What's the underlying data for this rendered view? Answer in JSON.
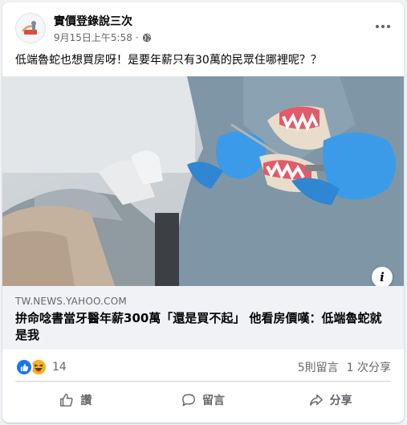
{
  "post": {
    "page_name": "實價登錄說三次",
    "timestamp": "9月15日上午5:58",
    "separator": "·",
    "privacy_icon": "globe-icon",
    "text": "低端魯蛇也想買房呀！是要年薪只有30萬的民眾住哪裡呢？？"
  },
  "link": {
    "domain": "TW.NEWS.YAHOO.COM",
    "title": "拚命唸書當牙醫年薪300萬「還是買不起」 他看房價嘆：低端魯蛇就是我"
  },
  "stats": {
    "reactions": [
      "like-icon",
      "haha-icon"
    ],
    "reaction_count": "14",
    "comments": "5則留言",
    "shares": "1 次分享"
  },
  "actions": {
    "like": "讚",
    "comment": "留言",
    "share": "分享"
  },
  "colors": {
    "accent": "#1877f2",
    "haha": "#f7b125",
    "secondary_text": "#65676b",
    "glove": "#3b9be8"
  }
}
